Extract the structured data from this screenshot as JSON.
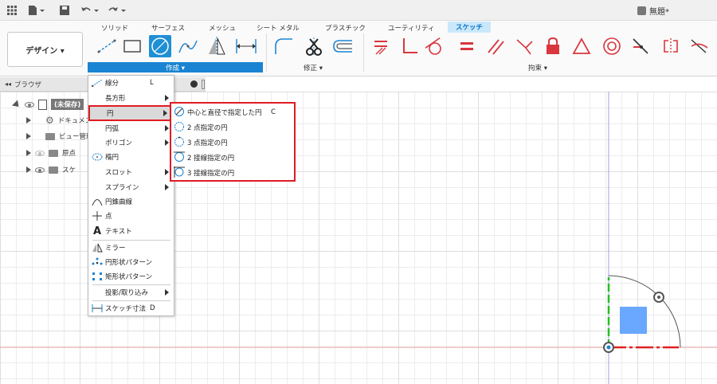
{
  "titlebar": {
    "document_title": "無題*",
    "icons": [
      "grid-icon",
      "file-icon",
      "save-icon",
      "undo-icon",
      "redo-icon"
    ]
  },
  "ribbon": {
    "tabs": [
      "ソリッド",
      "サーフェス",
      "メッシュ",
      "シート メタル",
      "プラスチック",
      "ユーティリティ",
      "スケッチ"
    ],
    "active_tab": "スケッチ",
    "workspace_button": "デザイン ▾",
    "groups": {
      "create": "作成 ▾",
      "modify": "修正 ▾",
      "constraints": "拘束 ▾"
    },
    "accent_color": "#1b84d2",
    "constraint_color": "#d9363e"
  },
  "browser": {
    "title": "ブラウザ",
    "root_label": "(未保存)",
    "items": [
      {
        "label": "ドキュメン",
        "icon": "gear-icon"
      },
      {
        "label": "ビュー管理",
        "icon": "folder-icon"
      },
      {
        "label": "原点",
        "icon": "folder-icon"
      },
      {
        "label": "スケ",
        "icon": "folder-icon"
      }
    ]
  },
  "create_menu": {
    "items": [
      {
        "label": "線分",
        "shortcut": "L",
        "icon": "line-icon",
        "submenu": false
      },
      {
        "label": "長方形",
        "shortcut": "",
        "icon": "",
        "submenu": true
      },
      {
        "label": "円",
        "shortcut": "",
        "icon": "",
        "submenu": true,
        "highlighted": true
      },
      {
        "label": "円弧",
        "shortcut": "",
        "icon": "",
        "submenu": true
      },
      {
        "label": "ポリゴン",
        "shortcut": "",
        "icon": "",
        "submenu": true
      },
      {
        "label": "楕円",
        "shortcut": "",
        "icon": "ellipse-icon",
        "submenu": false
      },
      {
        "label": "スロット",
        "shortcut": "",
        "icon": "",
        "submenu": true
      },
      {
        "label": "スプライン",
        "shortcut": "",
        "icon": "",
        "submenu": true
      },
      {
        "label": "円錐曲線",
        "shortcut": "",
        "icon": "conic-icon",
        "submenu": false
      },
      {
        "label": "点",
        "shortcut": "",
        "icon": "point-icon",
        "submenu": false
      },
      {
        "label": "テキスト",
        "shortcut": "",
        "icon": "text-icon",
        "submenu": false
      },
      {
        "label": "ミラー",
        "shortcut": "",
        "icon": "mirror-icon",
        "submenu": false
      },
      {
        "label": "円形状パターン",
        "shortcut": "",
        "icon": "circular-pattern-icon",
        "submenu": false
      },
      {
        "label": "矩形状パターン",
        "shortcut": "",
        "icon": "rectangular-pattern-icon",
        "submenu": false
      },
      {
        "label": "投影/取り込み",
        "shortcut": "",
        "icon": "",
        "submenu": true
      },
      {
        "label": "スケッチ寸法",
        "shortcut": "D",
        "icon": "dimension-icon",
        "submenu": false
      }
    ]
  },
  "circle_submenu": {
    "items": [
      {
        "label": "中心と直径で指定した円",
        "shortcut": "C"
      },
      {
        "label": "2 点指定の円",
        "shortcut": ""
      },
      {
        "label": "3 点指定の円",
        "shortcut": ""
      },
      {
        "label": "2 接線指定の円",
        "shortcut": ""
      },
      {
        "label": "3 接線指定の円",
        "shortcut": ""
      }
    ]
  },
  "colors": {
    "highlight_border": "#e01b24",
    "axis_red": "#e02020",
    "axis_green": "#22c022",
    "sketch_blue": "#6aa8ff"
  }
}
